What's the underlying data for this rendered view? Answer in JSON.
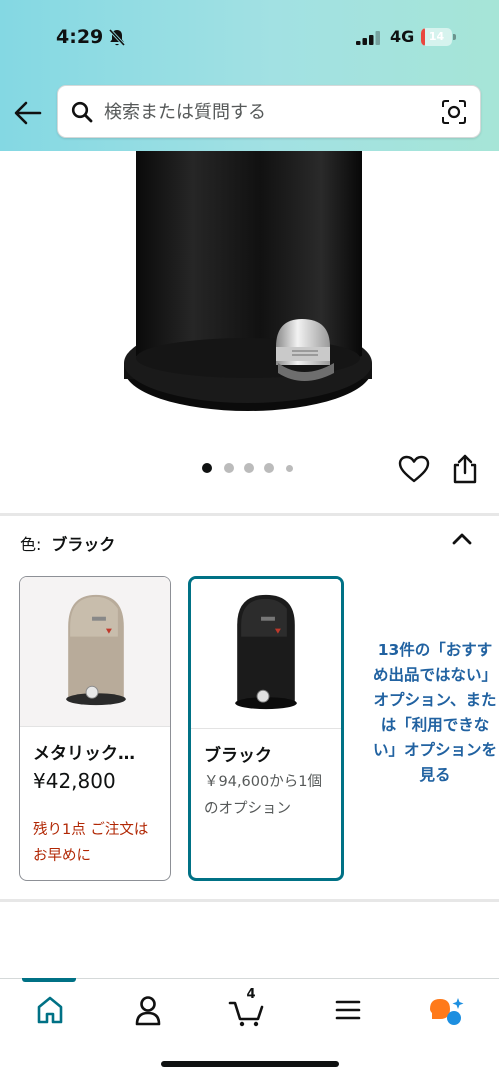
{
  "status_bar": {
    "time": "4:29",
    "network": "4G",
    "battery_level": "14",
    "battery_fraction": 0.14,
    "battery_color": "#e9473f"
  },
  "header": {
    "gradient": [
      "#84d8e3",
      "#a6e5d7"
    ],
    "search": {
      "placeholder": "検索または質問する",
      "value": ""
    }
  },
  "product": {
    "carousel": {
      "total_images": 5,
      "active_index": 0
    }
  },
  "color_selector": {
    "label": "色:",
    "selected_value": "ブラック",
    "options": [
      {
        "name": "メタリック…",
        "price": "¥42,800",
        "note": "残り1点 ご注文はお早めに",
        "image_color": "#b8ab9a",
        "selected": false
      },
      {
        "name": "ブラック",
        "price_text": "￥94,600から1個のオプション",
        "image_color": "#1b1b1b",
        "selected": true
      }
    ],
    "more_options_link": "13件の「おすすめ出品ではない」オプション、または「利用できない」オプションを見る"
  },
  "colors": {
    "accent": "#007185",
    "link": "#2162a1",
    "alert": "#b12704"
  },
  "bottom_nav": {
    "cart_count": "4",
    "items": [
      "home-icon",
      "account-icon",
      "cart-icon",
      "menu-icon",
      "rufus-ai-icon"
    ],
    "active": "home-icon"
  }
}
